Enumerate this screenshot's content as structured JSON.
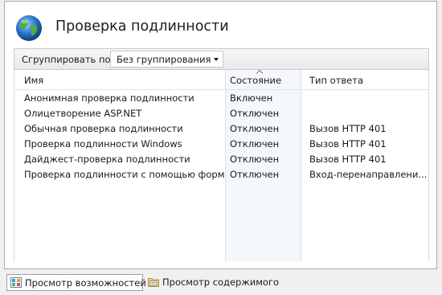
{
  "page": {
    "title": "Проверка подлинности"
  },
  "grouping": {
    "label": "Сгруппировать по:",
    "value": "Без группирования"
  },
  "table": {
    "columns": [
      "Имя",
      "Состояние",
      "Тип ответа"
    ],
    "rows": [
      [
        "Анонимная проверка подлинности",
        "Включен",
        ""
      ],
      [
        "Олицетворение ASP.NET",
        "Отключен",
        ""
      ],
      [
        "Обычная проверка подлинности",
        "Отключен",
        "Вызов HTTP 401"
      ],
      [
        "Проверка подлинности Windows",
        "Отключен",
        "Вызов HTTP 401"
      ],
      [
        "Дайджест-проверка подлинности",
        "Отключен",
        "Вызов HTTP 401"
      ],
      [
        "Проверка подлинности с помощью форм",
        "Отключен",
        "Вход-перенаправлени..."
      ]
    ]
  },
  "views": {
    "features": "Просмотр возможностей",
    "content": "Просмотр содержимого"
  },
  "icons": {
    "title": "globe-icon",
    "features": "features-view-icon",
    "content": "content-view-icon",
    "sort": "sort-ascending-icon"
  },
  "colors": {
    "sort_column": "#f4f7fb",
    "globe": "#2a6fc4"
  }
}
